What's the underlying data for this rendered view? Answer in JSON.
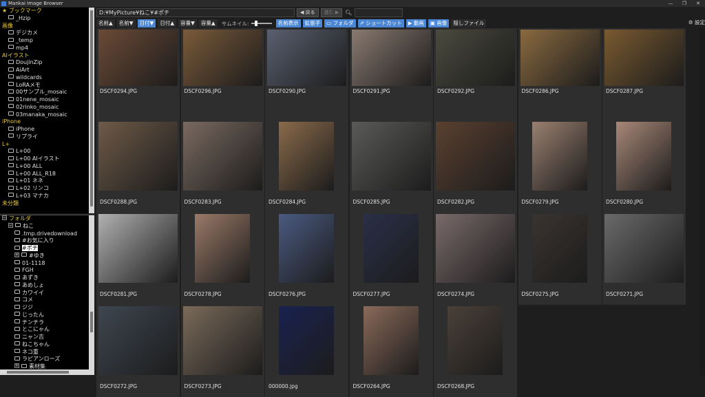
{
  "window": {
    "title": "Mankai Image Browser",
    "minimize": "—",
    "maximize": "❐",
    "close": "✕"
  },
  "sidebar_top": {
    "rows": [
      {
        "label": "ブックマーク",
        "type": "cat",
        "indent": 0,
        "prefix": "★"
      },
      {
        "label": "_Hzip",
        "type": "item",
        "indent": 1
      },
      {
        "label": "画像",
        "type": "cat",
        "indent": 0
      },
      {
        "label": "デジカメ",
        "type": "item",
        "indent": 1
      },
      {
        "label": "_temp",
        "type": "item",
        "indent": 1
      },
      {
        "label": "mp4",
        "type": "item",
        "indent": 1
      },
      {
        "label": "AIイラスト",
        "type": "cat",
        "indent": 0
      },
      {
        "label": "DoujinZip",
        "type": "item",
        "indent": 1
      },
      {
        "label": "AiArt",
        "type": "item",
        "indent": 1
      },
      {
        "label": "wildcards",
        "type": "item",
        "indent": 1
      },
      {
        "label": "LoRAメモ",
        "type": "item",
        "indent": 1
      },
      {
        "label": "00サンプル_mosaic",
        "type": "item",
        "indent": 1
      },
      {
        "label": "01nene_mosaic",
        "type": "item",
        "indent": 1
      },
      {
        "label": "02rinko_mosaic",
        "type": "item",
        "indent": 1
      },
      {
        "label": "03manaka_mosaic",
        "type": "item",
        "indent": 1
      },
      {
        "label": "iPhone",
        "type": "cat",
        "indent": 0
      },
      {
        "label": "iPhone",
        "type": "item",
        "indent": 1
      },
      {
        "label": "リプライ",
        "type": "item",
        "indent": 1
      },
      {
        "label": "L+",
        "type": "cat",
        "indent": 0
      },
      {
        "label": "L+00",
        "type": "item",
        "indent": 1
      },
      {
        "label": "L+00 AIイラスト",
        "type": "item",
        "indent": 1
      },
      {
        "label": "L+00 ALL",
        "type": "item",
        "indent": 1
      },
      {
        "label": "L+00 ALL_R18",
        "type": "item",
        "indent": 1
      },
      {
        "label": "L+01 ネネ",
        "type": "item",
        "indent": 1
      },
      {
        "label": "L+02 リンコ",
        "type": "item",
        "indent": 1
      },
      {
        "label": "L+03 マナカ",
        "type": "item",
        "indent": 1
      },
      {
        "label": "未分類",
        "type": "cat",
        "indent": 0
      }
    ]
  },
  "sidebar_bottom": {
    "rows": [
      {
        "label": "フォルダ",
        "type": "cat",
        "indent": 0,
        "expander": "−"
      },
      {
        "label": "ねこ",
        "type": "item",
        "indent": 1,
        "expander": "−"
      },
      {
        "label": ".tmp.drivedownload",
        "type": "item",
        "indent": 2
      },
      {
        "label": "#お気に入り",
        "type": "item",
        "indent": 2
      },
      {
        "label": "#ポチ",
        "type": "item",
        "indent": 2,
        "selected": true
      },
      {
        "label": "#ゆき",
        "type": "item",
        "indent": 2,
        "expander": "+"
      },
      {
        "label": "01-1118",
        "type": "item",
        "indent": 2
      },
      {
        "label": "FGH",
        "type": "item",
        "indent": 2
      },
      {
        "label": "あずき",
        "type": "item",
        "indent": 2
      },
      {
        "label": "あめしょ",
        "type": "item",
        "indent": 2
      },
      {
        "label": "カワイイ",
        "type": "item",
        "indent": 2
      },
      {
        "label": "コメ",
        "type": "item",
        "indent": 2
      },
      {
        "label": "ジジ",
        "type": "item",
        "indent": 2
      },
      {
        "label": "じったん",
        "type": "item",
        "indent": 2
      },
      {
        "label": "チンチラ",
        "type": "item",
        "indent": 2
      },
      {
        "label": "とこにゃん",
        "type": "item",
        "indent": 2
      },
      {
        "label": "ニャン吉",
        "type": "item",
        "indent": 2
      },
      {
        "label": "ねこちゃん",
        "type": "item",
        "indent": 2
      },
      {
        "label": "ネコ重",
        "type": "item",
        "indent": 2
      },
      {
        "label": "ラピアンローズ",
        "type": "item",
        "indent": 2
      },
      {
        "label": "素材集",
        "type": "item",
        "indent": 2,
        "expander": "+"
      }
    ]
  },
  "pathbar": {
    "path": "D:¥MyPicture¥ねこ¥#ポチ",
    "back": "◀ 戻る",
    "forward": "進む ▶",
    "search_icon": "search-icon"
  },
  "toolbar": {
    "buttons": [
      {
        "label": "名前▲",
        "blue": false
      },
      {
        "label": "名前▼",
        "blue": false
      },
      {
        "label": "日付▼",
        "blue": true
      },
      {
        "label": "日付▲",
        "blue": false
      },
      {
        "label": "容量▼",
        "blue": false
      },
      {
        "label": "容量▲",
        "blue": false
      }
    ],
    "thumb_label": "サムネイル:",
    "thumb_level": 0.2,
    "toggles": [
      {
        "label": "名前表示",
        "blue": true
      },
      {
        "label": "拡張子",
        "blue": true
      },
      {
        "label": "▭ フォルダ",
        "blue": true
      },
      {
        "label": "⇗ ショートカット",
        "blue": true
      },
      {
        "label": "▶ 動画",
        "blue": true
      },
      {
        "label": "▣ 画像",
        "blue": true
      },
      {
        "label": "隠しファイル",
        "blue": false
      }
    ],
    "settings": "⚙ 設定"
  },
  "images": [
    {
      "name": "DSCF0294.JPG",
      "color": "#6b4a36",
      "shape": "wide"
    },
    {
      "name": "DSCF0296.JPG",
      "color": "#7a5a3a",
      "shape": "wide"
    },
    {
      "name": "DSCF0290.JPG",
      "color": "#5a6070",
      "shape": "wide"
    },
    {
      "name": "DSCF0291.JPG",
      "color": "#8a7a70",
      "shape": "wide"
    },
    {
      "name": "DSCF0292.JPG",
      "color": "#4a4a3e",
      "shape": "wide"
    },
    {
      "name": "DSCF0286.JPG",
      "color": "#8a6a40",
      "shape": "wide"
    },
    {
      "name": "DSCF0287.JPG",
      "color": "#7a5a30",
      "shape": "wide"
    },
    {
      "name": "DSCF0288.JPG",
      "color": "#6e5a48",
      "shape": "wide"
    },
    {
      "name": "DSCF0283.JPG",
      "color": "#7a6a60",
      "shape": "wide"
    },
    {
      "name": "DSCF0284.JPG",
      "color": "#8a6a4a",
      "shape": "tall"
    },
    {
      "name": "DSCF0285.JPG",
      "color": "#5a5a58",
      "shape": "wide"
    },
    {
      "name": "DSCF0282.JPG",
      "color": "#5a4030",
      "shape": "wide"
    },
    {
      "name": "DSCF0279.JPG",
      "color": "#9a8070",
      "shape": "tall"
    },
    {
      "name": "DSCF0280.JPG",
      "color": "#a88878",
      "shape": "tall"
    },
    {
      "name": "DSCF0281.JPG",
      "color": "#b0b0b0",
      "shape": "wide"
    },
    {
      "name": "DSCF0278.JPG",
      "color": "#9a7a68",
      "shape": "tall"
    },
    {
      "name": "DSCF0276.JPG",
      "color": "#4a5a80",
      "shape": "tall"
    },
    {
      "name": "DSCF0277.JPG",
      "color": "#2a2f48",
      "shape": "tall"
    },
    {
      "name": "DSCF0274.JPG",
      "color": "#7a6a6a",
      "shape": "wide"
    },
    {
      "name": "DSCF0275.JPG",
      "color": "#3a3430",
      "shape": "tall"
    },
    {
      "name": "DSCF0271.JPG",
      "color": "#6a6a6a",
      "shape": "wide"
    },
    {
      "name": "DSCF0272.JPG",
      "color": "#3e4650",
      "shape": "wide"
    },
    {
      "name": "DSCF0273.JPG",
      "color": "#7a6a5a",
      "shape": "wide"
    },
    {
      "name": "000000.jpg",
      "color": "#1a2250",
      "shape": "tall"
    },
    {
      "name": "DSCF0264.JPG",
      "color": "#8a6a5a",
      "shape": "tall"
    },
    {
      "name": "DSCF0268.JPG",
      "color": "#4a4038",
      "shape": "tall"
    }
  ]
}
